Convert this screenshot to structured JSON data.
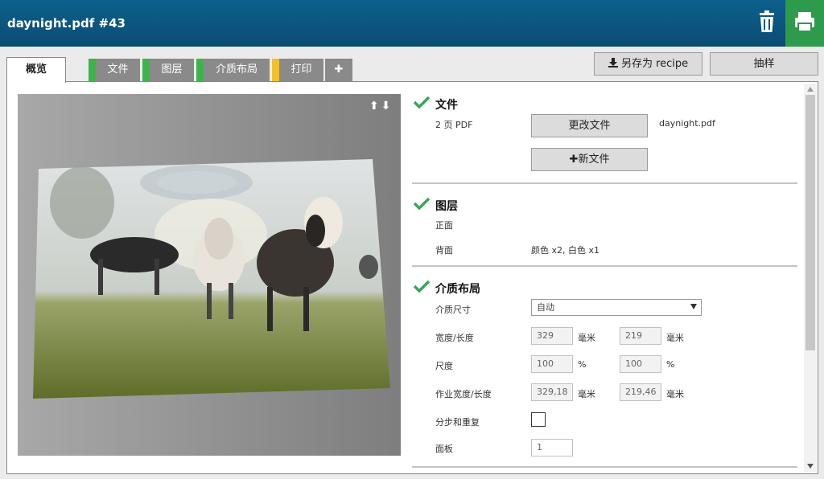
{
  "window": {
    "title": "daynight.pdf #43"
  },
  "icons": {
    "trash": "trash-icon",
    "print": "printer-icon",
    "check": "checkmark-icon",
    "download": "download-icon",
    "plus": "plus-icon",
    "arrows": "up-down-arrows-icon"
  },
  "colors": {
    "header": "#0a4d74",
    "print_button": "#2e9a4c",
    "check": "#3aa655",
    "tab_status_green": "#3cb44a",
    "tab_status_yellow": "#f2c12e"
  },
  "tabs": [
    {
      "label": "概览"
    },
    {
      "label": "文件"
    },
    {
      "label": "图层"
    },
    {
      "label": "介质布局"
    },
    {
      "label": "打印"
    },
    {
      "label": "✚"
    }
  ],
  "toolbar": {
    "save_recipe": "另存为 recipe",
    "sample": "抽样"
  },
  "preview": {
    "arrows": "⬆⬇"
  },
  "file": {
    "title": "文件",
    "pages": "2 页 PDF",
    "change_button": "更改文件",
    "filename": "daynight.pdf",
    "new_button": "新文件"
  },
  "layers": {
    "title": "图层",
    "front_label": "正面",
    "back_label": "背面",
    "back_value": "颜色 x2, 白色 x1"
  },
  "media_layout": {
    "title": "介质布局",
    "media_size_label": "介质尺寸",
    "media_size_value": "自动",
    "width_length_label": "宽度/长度",
    "width_value": "329",
    "length_value": "219",
    "unit_mm": "毫米",
    "scale_label": "尺度",
    "scale_x": "100",
    "scale_y": "100",
    "unit_percent": "%",
    "job_size_label": "作业宽度/长度",
    "job_width": "329,18",
    "job_length": "219,46",
    "step_repeat_label": "分步和重复",
    "panels_label": "面板",
    "panels_value": "1"
  }
}
